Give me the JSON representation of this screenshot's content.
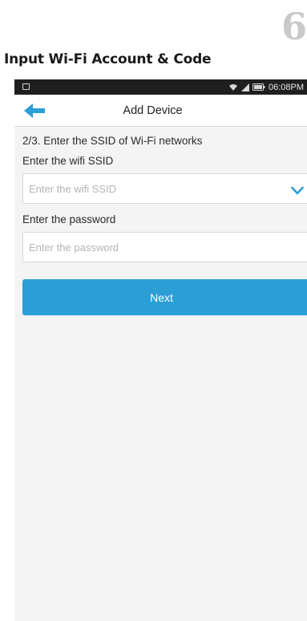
{
  "document": {
    "step_number": "6",
    "title": "Input Wi-Fi Account & Code"
  },
  "status_bar": {
    "time": "06:08PM",
    "icons": [
      "notification-icon",
      "wifi-icon",
      "signal-icon",
      "battery-icon"
    ]
  },
  "header": {
    "title": "Add Device",
    "back_icon": "back-arrow-icon"
  },
  "form": {
    "step_text": "2/3. Enter the SSID of Wi-Fi networks",
    "ssid_label": "Enter the wifi SSID",
    "ssid_value": "",
    "ssid_placeholder": "Enter the wifi SSID",
    "ssid_dropdown_icon": "chevron-down-icon",
    "password_label": "Enter the password",
    "password_value": "",
    "password_placeholder": "Enter the password",
    "next_label": "Next"
  },
  "colors": {
    "accent": "#2c9ed6",
    "status_bar": "#1f1f1f",
    "background": "#f4f4f4"
  }
}
